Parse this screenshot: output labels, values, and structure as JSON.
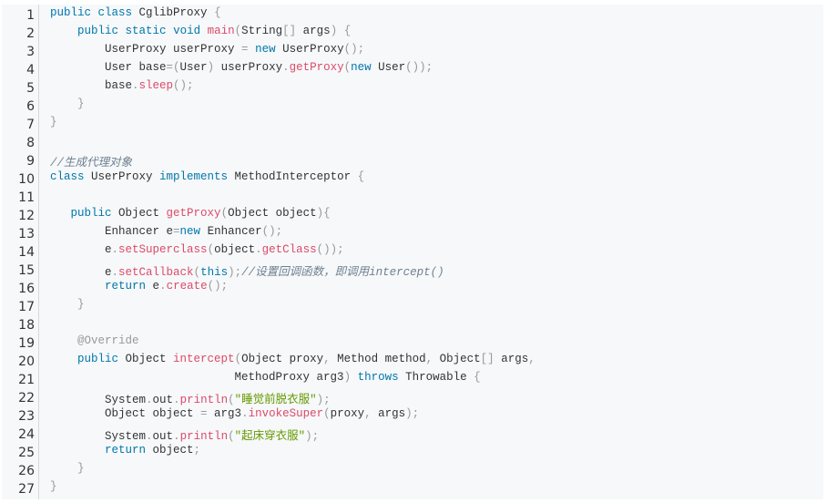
{
  "colors": {
    "keyword": "#0077aa",
    "function": "#dd4a68",
    "punctuation": "#999999",
    "string": "#669900",
    "comment": "#708090",
    "background": "#f6f8fa"
  },
  "code_lines": [
    [
      [
        "k",
        "public"
      ],
      [
        "t",
        " "
      ],
      [
        "k",
        "class"
      ],
      [
        "t",
        " CglibProxy "
      ],
      [
        "p",
        "{"
      ]
    ],
    [
      [
        "t",
        "    "
      ],
      [
        "k",
        "public"
      ],
      [
        "t",
        " "
      ],
      [
        "k",
        "static"
      ],
      [
        "t",
        " "
      ],
      [
        "k",
        "void"
      ],
      [
        "t",
        " "
      ],
      [
        "f",
        "main"
      ],
      [
        "p",
        "("
      ],
      [
        "t",
        "String"
      ],
      [
        "p",
        "[]"
      ],
      [
        "t",
        " args"
      ],
      [
        "p",
        ")"
      ],
      [
        "t",
        " "
      ],
      [
        "p",
        "{"
      ]
    ],
    [
      [
        "t",
        "        UserProxy userProxy "
      ],
      [
        "p",
        "="
      ],
      [
        "t",
        " "
      ],
      [
        "k",
        "new"
      ],
      [
        "t",
        " UserProxy"
      ],
      [
        "p",
        "();"
      ]
    ],
    [
      [
        "t",
        "        User base"
      ],
      [
        "p",
        "=("
      ],
      [
        "t",
        "User"
      ],
      [
        "p",
        ")"
      ],
      [
        "t",
        " userProxy"
      ],
      [
        "p",
        "."
      ],
      [
        "f",
        "getProxy"
      ],
      [
        "p",
        "("
      ],
      [
        "k",
        "new"
      ],
      [
        "t",
        " User"
      ],
      [
        "p",
        "());"
      ]
    ],
    [
      [
        "t",
        "        base"
      ],
      [
        "p",
        "."
      ],
      [
        "f",
        "sleep"
      ],
      [
        "p",
        "();"
      ]
    ],
    [
      [
        "t",
        "    "
      ],
      [
        "p",
        "}"
      ]
    ],
    [
      [
        "p",
        "}"
      ]
    ],
    [],
    [
      [
        "c",
        "//生成代理对象"
      ]
    ],
    [
      [
        "k",
        "class"
      ],
      [
        "t",
        " UserProxy "
      ],
      [
        "k",
        "implements"
      ],
      [
        "t",
        " MethodInterceptor "
      ],
      [
        "p",
        "{"
      ]
    ],
    [],
    [
      [
        "t",
        "   "
      ],
      [
        "k",
        "public"
      ],
      [
        "t",
        " Object "
      ],
      [
        "f",
        "getProxy"
      ],
      [
        "p",
        "("
      ],
      [
        "t",
        "Object object"
      ],
      [
        "p",
        ")"
      ],
      [
        "p",
        "{"
      ]
    ],
    [
      [
        "t",
        "        Enhancer e"
      ],
      [
        "p",
        "="
      ],
      [
        "k",
        "new"
      ],
      [
        "t",
        " Enhancer"
      ],
      [
        "p",
        "();"
      ]
    ],
    [
      [
        "t",
        "        e"
      ],
      [
        "p",
        "."
      ],
      [
        "f",
        "setSuperclass"
      ],
      [
        "p",
        "("
      ],
      [
        "t",
        "object"
      ],
      [
        "p",
        "."
      ],
      [
        "f",
        "getClass"
      ],
      [
        "p",
        "());"
      ]
    ],
    [
      [
        "t",
        "        e"
      ],
      [
        "p",
        "."
      ],
      [
        "f",
        "setCallback"
      ],
      [
        "p",
        "("
      ],
      [
        "k",
        "this"
      ],
      [
        "p",
        ");"
      ],
      [
        "c",
        "//设置回调函数，即调用intercept()"
      ]
    ],
    [
      [
        "t",
        "        "
      ],
      [
        "k",
        "return"
      ],
      [
        "t",
        " e"
      ],
      [
        "p",
        "."
      ],
      [
        "f",
        "create"
      ],
      [
        "p",
        "();"
      ]
    ],
    [
      [
        "t",
        "    "
      ],
      [
        "p",
        "}"
      ]
    ],
    [],
    [
      [
        "t",
        "    "
      ],
      [
        "a",
        "@Override"
      ]
    ],
    [
      [
        "t",
        "    "
      ],
      [
        "k",
        "public"
      ],
      [
        "t",
        " Object "
      ],
      [
        "f",
        "intercept"
      ],
      [
        "p",
        "("
      ],
      [
        "t",
        "Object proxy"
      ],
      [
        "p",
        ","
      ],
      [
        "t",
        " Method method"
      ],
      [
        "p",
        ","
      ],
      [
        "t",
        " Object"
      ],
      [
        "p",
        "[]"
      ],
      [
        "t",
        " args"
      ],
      [
        "p",
        ","
      ]
    ],
    [
      [
        "t",
        "                           MethodProxy arg3"
      ],
      [
        "p",
        ")"
      ],
      [
        "t",
        " "
      ],
      [
        "k",
        "throws"
      ],
      [
        "t",
        " Throwable "
      ],
      [
        "p",
        "{"
      ]
    ],
    [
      [
        "t",
        "        System"
      ],
      [
        "p",
        "."
      ],
      [
        "t",
        "out"
      ],
      [
        "p",
        "."
      ],
      [
        "f",
        "println"
      ],
      [
        "p",
        "("
      ],
      [
        "s",
        "\"睡觉前脱衣服\""
      ],
      [
        "p",
        ");"
      ]
    ],
    [
      [
        "t",
        "        Object object "
      ],
      [
        "p",
        "="
      ],
      [
        "t",
        " arg3"
      ],
      [
        "p",
        "."
      ],
      [
        "f",
        "invokeSuper"
      ],
      [
        "p",
        "("
      ],
      [
        "t",
        "proxy"
      ],
      [
        "p",
        ","
      ],
      [
        "t",
        " args"
      ],
      [
        "p",
        ");"
      ]
    ],
    [
      [
        "t",
        "        System"
      ],
      [
        "p",
        "."
      ],
      [
        "t",
        "out"
      ],
      [
        "p",
        "."
      ],
      [
        "f",
        "println"
      ],
      [
        "p",
        "("
      ],
      [
        "s",
        "\"起床穿衣服\""
      ],
      [
        "p",
        ");"
      ]
    ],
    [
      [
        "t",
        "        "
      ],
      [
        "k",
        "return"
      ],
      [
        "t",
        " object"
      ],
      [
        "p",
        ";"
      ]
    ],
    [
      [
        "t",
        "    "
      ],
      [
        "p",
        "}"
      ]
    ],
    [
      [
        "p",
        "}"
      ]
    ]
  ]
}
